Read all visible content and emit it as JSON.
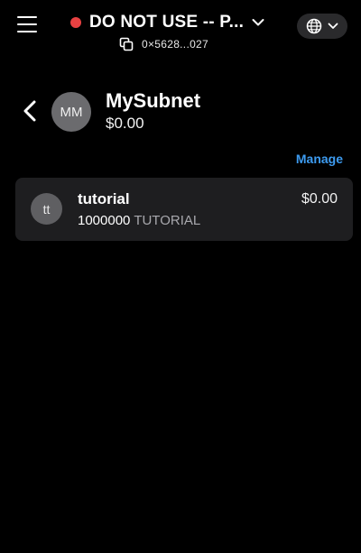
{
  "header": {
    "account_name": "DO NOT USE -- P...",
    "address": "0×5628...027",
    "icons": {
      "menu": "hamburger-icon",
      "status": "status-dot",
      "account_dropdown": "chevron-down-icon",
      "copy": "copy-icon",
      "network": "globe-icon",
      "network_dropdown": "chevron-down-icon"
    }
  },
  "subnet": {
    "avatar_initials": "MM",
    "name": "MySubnet",
    "balance": "$0.00"
  },
  "actions": {
    "manage_label": "Manage"
  },
  "tokens": [
    {
      "avatar_initials": "tt",
      "name": "tutorial",
      "amount": "1000000",
      "symbol": "TUTORIAL",
      "value": "$0.00"
    }
  ],
  "colors": {
    "background": "#000000",
    "status_dot": "#e84142",
    "link": "#3d9bf0",
    "card": "#1e1e20",
    "pill": "#2a2a2c"
  }
}
